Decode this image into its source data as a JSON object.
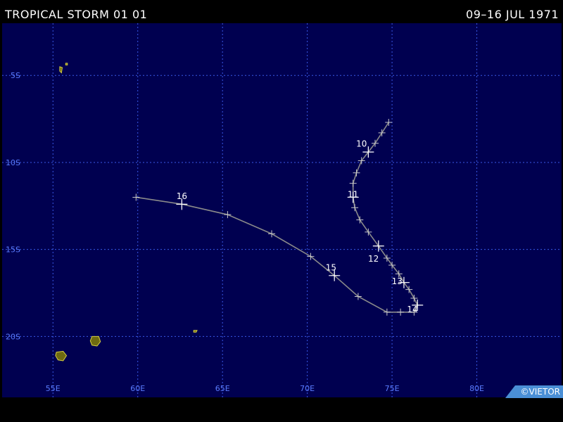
{
  "header": {
    "title": "TROPICAL STORM 01 01",
    "dates": "09–16 JUL 1971"
  },
  "copyright": "©VIETOR",
  "colors": {
    "background": "#000000",
    "ocean": "#000050",
    "grid": "#3a58e6",
    "axis_label": "#5a7cff",
    "track": "#8a8a8a",
    "marker": "#c8c8c8",
    "day_label": "#ffffff",
    "land_fill": "#6e6a10",
    "land_edge": "#d8d040"
  },
  "map": {
    "lon_range": [
      52,
      85
    ],
    "lat_range": [
      -2,
      -23.5
    ],
    "lon_ticks": [
      {
        "value": 55,
        "label": "55E"
      },
      {
        "value": 60,
        "label": "60E"
      },
      {
        "value": 65,
        "label": "65E"
      },
      {
        "value": 70,
        "label": "70E"
      },
      {
        "value": 75,
        "label": "75E"
      },
      {
        "value": 80,
        "label": "80E"
      }
    ],
    "lat_ticks": [
      {
        "value": -5,
        "label": "5S"
      },
      {
        "value": -10,
        "label": "10S"
      },
      {
        "value": -15,
        "label": "15S"
      },
      {
        "value": -20,
        "label": "20S"
      }
    ]
  },
  "track": {
    "points": [
      [
        74.8,
        -7.7
      ],
      [
        74.4,
        -8.3
      ],
      [
        74.0,
        -8.9
      ],
      [
        73.6,
        -9.4
      ],
      [
        73.2,
        -9.9
      ],
      [
        72.9,
        -10.6
      ],
      [
        72.7,
        -11.2
      ],
      [
        72.7,
        -12.0
      ],
      [
        72.8,
        -12.6
      ],
      [
        73.1,
        -13.3
      ],
      [
        73.6,
        -14.0
      ],
      [
        74.2,
        -14.8
      ],
      [
        74.7,
        -15.5
      ],
      [
        75.0,
        -15.9
      ],
      [
        75.4,
        -16.4
      ],
      [
        75.7,
        -16.9
      ],
      [
        76.0,
        -17.3
      ],
      [
        76.3,
        -17.8
      ],
      [
        76.5,
        -18.2
      ],
      [
        76.3,
        -18.6
      ],
      [
        75.5,
        -18.6
      ],
      [
        74.7,
        -18.6
      ],
      [
        73.0,
        -17.7
      ],
      [
        71.6,
        -16.5
      ],
      [
        70.2,
        -15.4
      ],
      [
        67.9,
        -14.1
      ],
      [
        65.3,
        -13.0
      ],
      [
        62.6,
        -12.4
      ],
      [
        59.9,
        -12.0
      ]
    ],
    "major_markers": [
      [
        73.6,
        -9.4
      ],
      [
        72.7,
        -12.0
      ],
      [
        74.2,
        -14.8
      ],
      [
        75.7,
        -16.9
      ],
      [
        76.5,
        -18.2
      ],
      [
        71.6,
        -16.5
      ],
      [
        62.6,
        -12.4
      ]
    ],
    "day_labels": [
      {
        "text": "10",
        "lon": 73.2,
        "lat": -9.1
      },
      {
        "text": "11",
        "lon": 72.7,
        "lat": -12.0
      },
      {
        "text": "12",
        "lon": 73.9,
        "lat": -15.7
      },
      {
        "text": "13",
        "lon": 75.3,
        "lat": -17.0
      },
      {
        "text": "14",
        "lon": 76.2,
        "lat": -18.6
      },
      {
        "text": "15",
        "lon": 71.4,
        "lat": -16.2
      },
      {
        "text": "16",
        "lon": 62.6,
        "lat": -12.1
      }
    ]
  },
  "islands": [
    {
      "name": "Mauritius",
      "points": [
        [
          57.3,
          -20.0
        ],
        [
          57.7,
          -20.0
        ],
        [
          57.8,
          -20.3
        ],
        [
          57.6,
          -20.55
        ],
        [
          57.3,
          -20.5
        ],
        [
          57.2,
          -20.25
        ]
      ]
    },
    {
      "name": "Reunion",
      "points": [
        [
          55.2,
          -20.9
        ],
        [
          55.6,
          -20.85
        ],
        [
          55.8,
          -21.1
        ],
        [
          55.6,
          -21.4
        ],
        [
          55.3,
          -21.35
        ],
        [
          55.15,
          -21.1
        ]
      ]
    },
    {
      "name": "Rodrigues",
      "points": [
        [
          63.3,
          -19.65
        ],
        [
          63.5,
          -19.65
        ],
        [
          63.45,
          -19.75
        ],
        [
          63.3,
          -19.75
        ]
      ]
    },
    {
      "name": "Seychelles Mahe",
      "points": [
        [
          55.4,
          -4.5
        ],
        [
          55.55,
          -4.55
        ],
        [
          55.5,
          -4.85
        ],
        [
          55.4,
          -4.75
        ]
      ]
    },
    {
      "name": "Seychelles Praslin",
      "points": [
        [
          55.75,
          -4.3
        ],
        [
          55.85,
          -4.3
        ],
        [
          55.85,
          -4.4
        ],
        [
          55.75,
          -4.4
        ]
      ]
    }
  ]
}
